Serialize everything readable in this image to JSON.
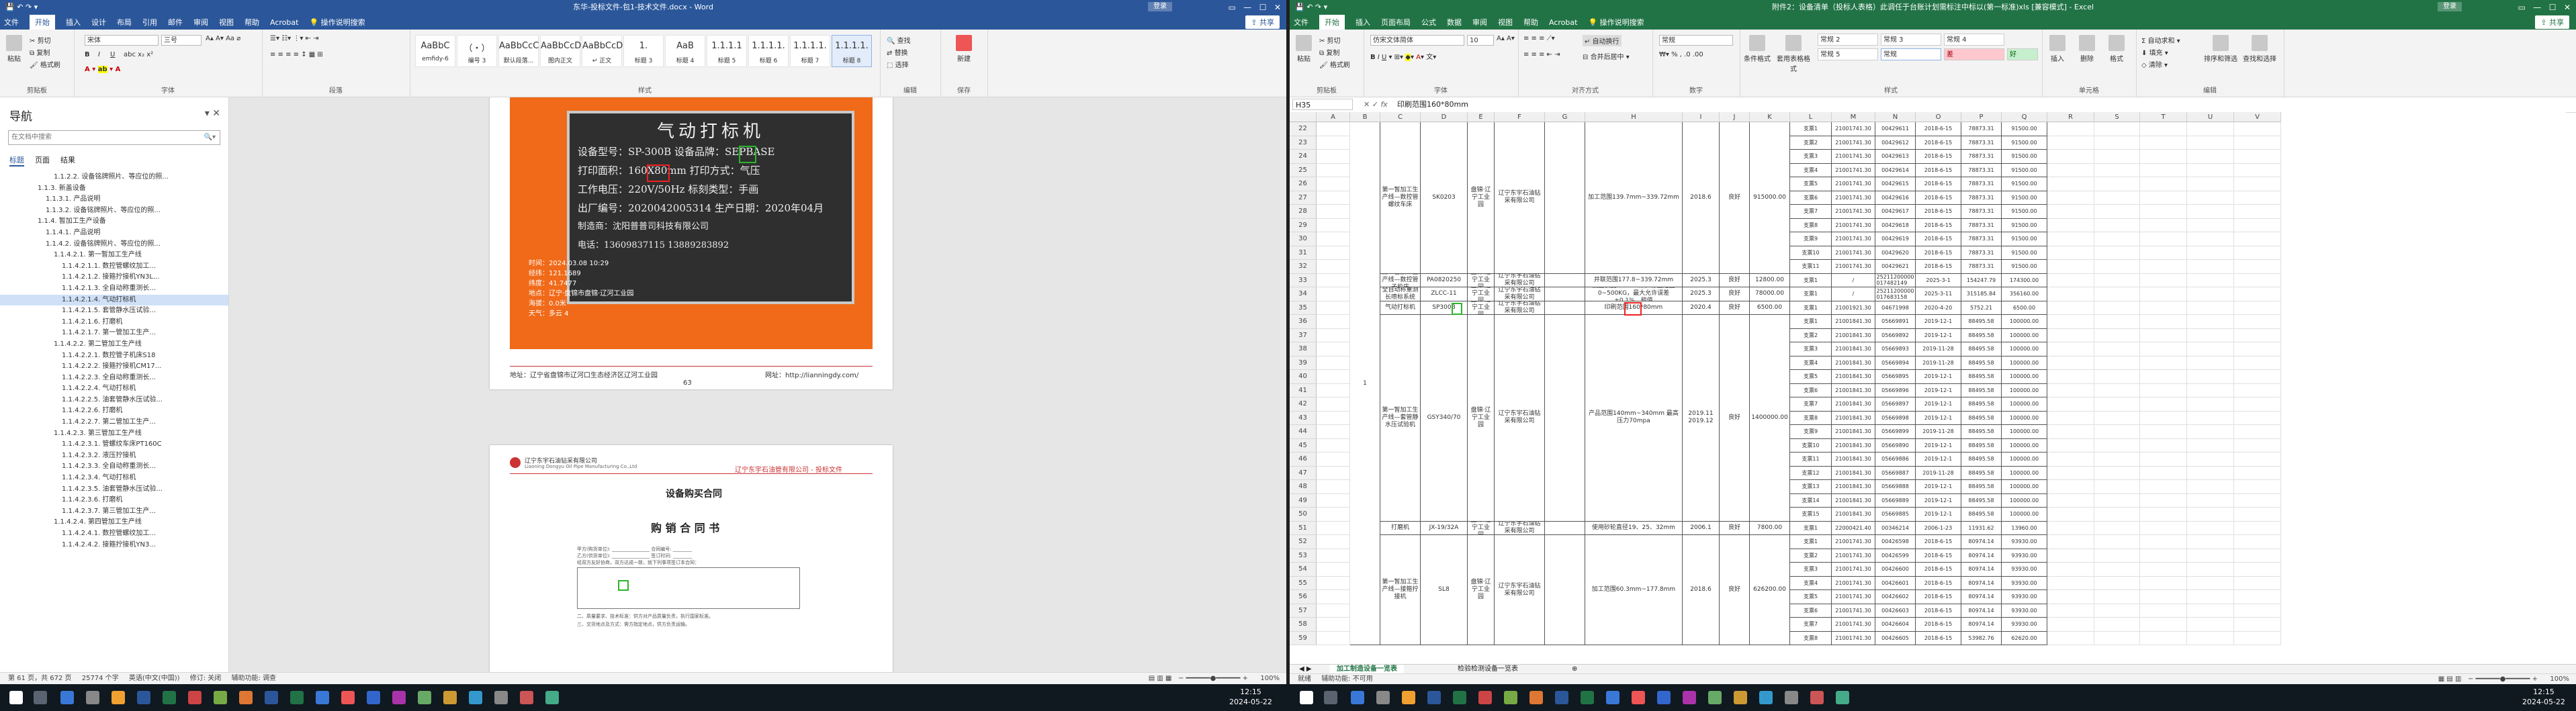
{
  "word": {
    "title": "东华-投标文件-包1-技术文件.docx  -  Word",
    "login": "登录",
    "menu": [
      "文件",
      "开始",
      "插入",
      "设计",
      "布局",
      "引用",
      "邮件",
      "审阅",
      "视图",
      "帮助",
      "Acrobat",
      "操作说明搜索"
    ],
    "share": "共享",
    "ribbon": {
      "paste": "粘贴",
      "cut": "剪切",
      "copy": "复制",
      "format_painter": "格式刷",
      "clipboard": "剪贴板",
      "font_name": "宋体",
      "font_size": "三号",
      "font": "字体",
      "paragraph": "段落",
      "styles_label": "样式",
      "styles": [
        {
          "sample": "AaBbC",
          "name": "emfidy-6"
        },
        {
          "sample": "（・）",
          "name": "编号 3"
        },
        {
          "sample": "AaBbCcC",
          "name": "默认段落..."
        },
        {
          "sample": "AaBbCcD",
          "name": "图内正文"
        },
        {
          "sample": "AaBbCcD",
          "name": "↵ 正文"
        },
        {
          "sample": "1.",
          "name": "标题 3"
        },
        {
          "sample": "AaB",
          "name": "标题 4"
        },
        {
          "sample": "1.1.1.1",
          "name": "标题 5"
        },
        {
          "sample": "1.1.1.1.",
          "name": "标题 6"
        },
        {
          "sample": "1.1.1.1.",
          "name": "标题 7"
        },
        {
          "sample": "1.1.1.1.",
          "name": "标题 8"
        }
      ],
      "find": "查找",
      "replace": "替换",
      "select": "选择",
      "editing": "编辑",
      "wps": "新建",
      "save_label": "保存"
    },
    "nav": {
      "title": "导航",
      "search_placeholder": "在文档中搜索",
      "tabs": [
        "标题",
        "页面",
        "结果"
      ],
      "items": [
        {
          "text": "1.1.2.2. 设备铭牌照片、等应位的照...",
          "indent": 60
        },
        {
          "text": "1.1.3. 新盖设备",
          "indent": 36
        },
        {
          "text": "1.1.3.1. 产品说明",
          "indent": 48
        },
        {
          "text": "1.1.3.2. 设备铭牌照片、等应位的照...",
          "indent": 48
        },
        {
          "text": "1.1.4. 暂加工生产设备",
          "indent": 36
        },
        {
          "text": "1.1.4.1. 产品说明",
          "indent": 48
        },
        {
          "text": "1.1.4.2. 设备铭牌照片、等应位的照...",
          "indent": 48
        },
        {
          "text": "1.1.4.2.1. 第一暂加工生产线",
          "indent": 60
        },
        {
          "text": "1.1.4.2.1.1. 数控管螺纹加工...",
          "indent": 72
        },
        {
          "text": "1.1.4.2.1.2. 接箍拧接机YN3L...",
          "indent": 72
        },
        {
          "text": "1.1.4.2.1.3. 全自动称重测长...",
          "indent": 72
        },
        {
          "text": "1.1.4.2.1.4. 气动打标机",
          "indent": 72,
          "sel": true
        },
        {
          "text": "1.1.4.2.1.5. 套管静水压试验...",
          "indent": 72
        },
        {
          "text": "1.1.4.2.1.6. 打磨机",
          "indent": 72
        },
        {
          "text": "1.1.4.2.1.7. 第一管加工生产...",
          "indent": 72
        },
        {
          "text": "1.1.4.2.2. 第二管加工生产线",
          "indent": 60
        },
        {
          "text": "1.1.4.2.2.1. 数控管子机床S18",
          "indent": 72
        },
        {
          "text": "1.1.4.2.2.2. 接箍拧接机CM17...",
          "indent": 72
        },
        {
          "text": "1.1.4.2.2.3. 全自动称重测长...",
          "indent": 72
        },
        {
          "text": "1.1.4.2.2.4. 气动打标机",
          "indent": 72
        },
        {
          "text": "1.1.4.2.2.5. 油套管静水压试验...",
          "indent": 72
        },
        {
          "text": "1.1.4.2.2.6. 打磨机",
          "indent": 72
        },
        {
          "text": "1.1.4.2.2.7. 第二管加工生产...",
          "indent": 72
        },
        {
          "text": "1.1.4.2.3. 第三管加工生产线",
          "indent": 60
        },
        {
          "text": "1.1.4.2.3.1. 管螺纹车床PT160C",
          "indent": 72
        },
        {
          "text": "1.1.4.2.3.2. 液压拧接机",
          "indent": 72
        },
        {
          "text": "1.1.4.2.3.3. 全自动称重测长...",
          "indent": 72
        },
        {
          "text": "1.1.4.2.3.4. 气动打标机",
          "indent": 72
        },
        {
          "text": "1.1.4.2.3.5. 油套管静水压试验...",
          "indent": 72
        },
        {
          "text": "1.1.4.2.3.6. 打磨机",
          "indent": 72
        },
        {
          "text": "1.1.4.2.3.7. 第三管加工生产...",
          "indent": 72
        },
        {
          "text": "1.1.4.2.4. 第四管加工生产线",
          "indent": 60
        },
        {
          "text": "1.1.4.2.4.1. 数控管螺纹加工...",
          "indent": 72
        },
        {
          "text": "1.1.4.2.4.2. 接箍拧接机YN3...",
          "indent": 72
        }
      ]
    },
    "plate": {
      "title": "气动打标机",
      "rows": [
        "设备型号：SP-300B  设备品牌：SEPBASE",
        "打印面积：160X80mm   打印方式：气压",
        "工作电压：220V/50Hz   标刻类型：手画",
        "出厂编号：2020042005314 生产日期：2020年04月",
        "制造商：沈阳普普司科技有限公司",
        "电话：13609837115 13889283892"
      ],
      "photo_caption": [
        "时间：2024.03.08  10:29",
        "经纬：121.1689",
        "纬度：41.7477",
        "地点：辽宁·盘锦市盘锦·辽河工业园",
        "海拔：0.0米",
        "天气：多云 4"
      ]
    },
    "page1_footer_left": "地址：辽宁省盘锦市辽河口生态经济区辽河工业园",
    "page1_footer_right": "网址：http://lianningdy.com/",
    "page1_number": "63",
    "page2_header_company": "辽宁东宇石油钻采有限公司",
    "page2_header_en": "Liaoning Dongyu Oil Pipe Manufacturing Co.,Ltd",
    "page2_header_right": "辽宁东宇石油管有限公司 - 投标文件",
    "page2_section": "设备购买合同",
    "contract_title": "购 销 合 同 书",
    "status": {
      "page": "第 61 页，共 672 页",
      "words": "25774 个字",
      "lang": "英语(中文(中国))",
      "track": "修订: 关闭",
      "accessibility": "辅助功能: 调查",
      "zoom": "100%"
    }
  },
  "excel": {
    "title": "附件2：设备清单（投标人表格）此调任于台账计划需标注中标以(第一标准)xls [兼容模式]  -  Excel",
    "login": "登录",
    "menu": [
      "文件",
      "开始",
      "插入",
      "页面布局",
      "公式",
      "数据",
      "审阅",
      "视图",
      "帮助",
      "Acrobat",
      "操作说明搜索"
    ],
    "share": "共享",
    "ribbon": {
      "paste": "粘贴",
      "clipboard": "剪贴板",
      "font_name": "仿宋文体简体",
      "font_size": "10",
      "font": "字体",
      "alignment": "对齐方式",
      "wrap": "自动换行",
      "merge": "合并后居中",
      "number_format": "常规",
      "number": "数字",
      "cond_format": "条件格式",
      "table_format": "套用表格格式",
      "styles_label": "样式",
      "cell_styles": [
        {
          "name": "常规 2",
          "bg": "#ffffff"
        },
        {
          "name": "常规 3",
          "bg": "#ffffff"
        },
        {
          "name": "常规 4",
          "bg": "#ffffff"
        },
        {
          "name": "常规 5",
          "bg": "#ffffff"
        },
        {
          "name": "常规",
          "bg": "#ffffff"
        },
        {
          "name": "差",
          "bg": "#ffc7ce"
        },
        {
          "name": "好",
          "bg": "#c6efce"
        }
      ],
      "insert": "插入",
      "delete": "删除",
      "format": "格式",
      "cells": "单元格",
      "autosum": "自动求和",
      "fill": "填充",
      "clear": "清除",
      "sort_filter": "排序和筛选",
      "find_select": "查找和选择",
      "editing": "编辑"
    },
    "namebox": "H35",
    "formula": "印刷范围160*80mm",
    "columns": [
      "A",
      "B",
      "C",
      "D",
      "E",
      "F",
      "G",
      "H",
      "I",
      "J",
      "K",
      "L",
      "M",
      "N",
      "O",
      "P",
      "Q",
      "R",
      "S",
      "T",
      "U",
      "V"
    ],
    "rows": [
      {
        "num": "22",
        "l": "支票1",
        "m": "21001741.30",
        "n": "00429611",
        "o": "2018-6-15",
        "p": "78873.31",
        "q": "91500.00"
      },
      {
        "num": "23",
        "l": "支票2",
        "m": "21001741.30",
        "n": "00429612",
        "o": "2018-6-15",
        "p": "78873.31",
        "q": "91500.00"
      },
      {
        "num": "24",
        "l": "支票3",
        "m": "21001741.30",
        "n": "00429613",
        "o": "2018-6-15",
        "p": "78873.31",
        "q": "91500.00"
      },
      {
        "num": "25",
        "l": "支票4",
        "m": "21001741.30",
        "n": "00429614",
        "o": "2018-6-15",
        "p": "78873.31",
        "q": "91500.00"
      },
      {
        "num": "26",
        "l": "支票5",
        "m": "21001741.30",
        "n": "00429615",
        "o": "2018-6-15",
        "p": "78873.31",
        "q": "91500.00"
      },
      {
        "num": "27",
        "l": "支票6",
        "m": "21001741.30",
        "n": "00429616",
        "o": "2018-6-15",
        "p": "78873.31",
        "q": "91500.00"
      },
      {
        "num": "28",
        "l": "支票7",
        "m": "21001741.30",
        "n": "00429617",
        "o": "2018-6-15",
        "p": "78873.31",
        "q": "91500.00"
      },
      {
        "num": "29",
        "l": "支票8",
        "m": "21001741.30",
        "n": "00429618",
        "o": "2018-6-15",
        "p": "78873.31",
        "q": "91500.00"
      },
      {
        "num": "30",
        "l": "支票9",
        "m": "21001741.30",
        "n": "00429619",
        "o": "2018-6-15",
        "p": "78873.31",
        "q": "91500.00"
      },
      {
        "num": "31",
        "l": "支票10",
        "m": "21001741.30",
        "n": "00429620",
        "o": "2018-6-15",
        "p": "78873.31",
        "q": "91500.00"
      },
      {
        "num": "32",
        "l": "支票11",
        "m": "21001741.30",
        "n": "00429621",
        "o": "2018-6-15",
        "p": "78873.31",
        "q": "91500.00"
      },
      {
        "num": "33",
        "l": "支票1",
        "m": "/",
        "n": "25211200000\n017482149",
        "o": "2025-3-1",
        "p": "154247.79",
        "q": "174300.00"
      },
      {
        "num": "34",
        "l": "支票1",
        "m": "/",
        "n": "25211200000\n017683158",
        "o": "2025-3-11",
        "p": "315185.84",
        "q": "356160.00"
      },
      {
        "num": "35",
        "l": "支票1",
        "m": "21001921.30",
        "n": "04671998",
        "o": "2020-4-20",
        "p": "5752.21",
        "q": "6500.00"
      },
      {
        "num": "36",
        "l": "支票1",
        "m": "21001841.30",
        "n": "05669891",
        "o": "2019-12-1",
        "p": "88495.58",
        "q": "100000.00"
      },
      {
        "num": "37",
        "l": "支票2",
        "m": "21001841.30",
        "n": "05669892",
        "o": "2019-12-1",
        "p": "88495.58",
        "q": "100000.00"
      },
      {
        "num": "38",
        "l": "支票3",
        "m": "21001841.30",
        "n": "05669893",
        "o": "2019-11-28",
        "p": "88495.58",
        "q": "100000.00"
      },
      {
        "num": "39",
        "l": "支票4",
        "m": "21001841.30",
        "n": "05669894",
        "o": "2019-11-28",
        "p": "88495.58",
        "q": "100000.00"
      },
      {
        "num": "40",
        "l": "支票5",
        "m": "21001841.30",
        "n": "05669895",
        "o": "2019-12-1",
        "p": "88495.58",
        "q": "100000.00"
      },
      {
        "num": "41",
        "l": "支票6",
        "m": "21001841.30",
        "n": "05669896",
        "o": "2019-12-1",
        "p": "88495.58",
        "q": "100000.00"
      },
      {
        "num": "42",
        "l": "支票7",
        "m": "21001841.30",
        "n": "05669897",
        "o": "2019-12-1",
        "p": "88495.58",
        "q": "100000.00"
      },
      {
        "num": "43",
        "l": "支票8",
        "m": "21001841.30",
        "n": "05669898",
        "o": "2019-12-1",
        "p": "88495.58",
        "q": "100000.00"
      },
      {
        "num": "44",
        "l": "支票9",
        "m": "21001841.30",
        "n": "05669899",
        "o": "2019-11-28",
        "p": "88495.58",
        "q": "100000.00"
      },
      {
        "num": "45",
        "l": "支票10",
        "m": "21001841.30",
        "n": "05669890",
        "o": "2019-12-1",
        "p": "88495.58",
        "q": "100000.00"
      },
      {
        "num": "46",
        "l": "支票11",
        "m": "21001841.30",
        "n": "05669886",
        "o": "2019-12-1",
        "p": "88495.58",
        "q": "100000.00"
      },
      {
        "num": "47",
        "l": "支票12",
        "m": "21001841.30",
        "n": "05669887",
        "o": "2019-11-28",
        "p": "88495.58",
        "q": "100000.00"
      },
      {
        "num": "48",
        "l": "支票13",
        "m": "21001841.30",
        "n": "05669888",
        "o": "2019-12-1",
        "p": "88495.58",
        "q": "100000.00"
      },
      {
        "num": "49",
        "l": "支票14",
        "m": "21001841.30",
        "n": "05669889",
        "o": "2019-12-1",
        "p": "88495.58",
        "q": "100000.00"
      },
      {
        "num": "50",
        "l": "支票15",
        "m": "21001841.30",
        "n": "05669885",
        "o": "2019-12-1",
        "p": "88495.58",
        "q": "100000.00"
      },
      {
        "num": "51",
        "l": "支票1",
        "m": "22000421.40",
        "n": "00346214",
        "o": "2006-1-23",
        "p": "11931.62",
        "q": "13960.00"
      },
      {
        "num": "52",
        "l": "支票1",
        "m": "21001741.30",
        "n": "00426598",
        "o": "2018-6-15",
        "p": "80974.14",
        "q": "93930.00"
      },
      {
        "num": "53",
        "l": "支票2",
        "m": "21001741.30",
        "n": "00426599",
        "o": "2018-6-15",
        "p": "80974.14",
        "q": "93930.00"
      },
      {
        "num": "54",
        "l": "支票3",
        "m": "21001741.30",
        "n": "00426600",
        "o": "2018-6-15",
        "p": "80974.14",
        "q": "93930.00"
      },
      {
        "num": "55",
        "l": "支票4",
        "m": "21001741.30",
        "n": "00426601",
        "o": "2018-6-15",
        "p": "80974.14",
        "q": "93930.00"
      },
      {
        "num": "56",
        "l": "支票5",
        "m": "21001741.30",
        "n": "00426602",
        "o": "2018-6-15",
        "p": "80974.14",
        "q": "93930.00"
      },
      {
        "num": "57",
        "l": "支票6",
        "m": "21001741.30",
        "n": "00426603",
        "o": "2018-6-15",
        "p": "80974.14",
        "q": "93930.00"
      },
      {
        "num": "58",
        "l": "支票7",
        "m": "21001741.30",
        "n": "00426604",
        "o": "2018-6-15",
        "p": "80974.14",
        "q": "93930.00"
      },
      {
        "num": "59",
        "l": "支票8",
        "m": "21001741.30",
        "n": "00426605",
        "o": "2018-6-15",
        "p": "53982.76",
        "q": "62620.00"
      }
    ],
    "groups": [
      {
        "start": 0,
        "end": 10,
        "c": "第一暂加工生产线—数控管螺纹车床",
        "d": "SK0203",
        "e": "盘锦·辽宁工业园",
        "f": "辽宁东宇石油钻采有限公司",
        "h": "加工范围139.7mm~339.72mm",
        "i": "2018.6",
        "j": "良好",
        "k": "915000.00"
      },
      {
        "start": 11,
        "end": 11,
        "c": "第一暂加工生产线—数控管子机床",
        "d": "PA0820250",
        "e": "盘锦·辽宁工业园",
        "f": "辽宁东宇石油钻采有限公司",
        "h": "并联范围177.8~339.72mm",
        "i": "2025.3",
        "j": "良好",
        "k": "12800.00"
      },
      {
        "start": 12,
        "end": 12,
        "c": "全自动称重测长喷标系统",
        "d": "ZLCC-11",
        "e": "盘锦·辽宁工业园",
        "f": "辽宁东宇石油钻采有限公司",
        "h": "测量长度9~12.5米，称重范围0~500KG，最大允许误差±0.1%，称值",
        "i": "2025.3",
        "j": "良好",
        "k": "78000.00"
      },
      {
        "start": 13,
        "end": 13,
        "c": "气动打标机",
        "d": "SP300B",
        "e": "盘锦·辽宁工业园",
        "f": "辽宁东宇石油钻采有限公司",
        "h": "印刷范围160*80mm",
        "i": "2020.4",
        "j": "良好",
        "k": "6500.00"
      },
      {
        "start": 14,
        "end": 28,
        "c": "第一暂加工生产线—套管静水压试验机",
        "d": "GSY340/70",
        "e": "盘锦·辽宁工业园",
        "f": "辽宁东宇石油钻采有限公司",
        "h": "产品范围140mm~340mm 最高压力70mpa",
        "i": "2019.11\n2019.12",
        "j": "良好",
        "k": "1400000.00"
      },
      {
        "start": 29,
        "end": 29,
        "c": "打磨机",
        "d": "JX-19/32A",
        "e": "盘锦·辽宁工业园",
        "f": "辽宁东宇石油钻采有限公司",
        "h": "使用砂轮直径19、25、32mm",
        "i": "2006.1",
        "j": "良好",
        "k": "7800.00"
      },
      {
        "start": 30,
        "end": 37,
        "c": "第一暂加工生产线—接箍拧接机",
        "d": "SL8",
        "e": "盘锦·辽宁工业园",
        "f": "辽宁东宇石油钻采有限公司",
        "h": "加工范围60.3mm~177.8mm",
        "i": "2018.6",
        "j": "良好",
        "k": "626200.00"
      }
    ],
    "b_value": "1",
    "sheets": [
      "加工制造设备一览表",
      "检验检测设备一览表"
    ],
    "status": {
      "ready": "就绪",
      "accessibility": "辅助功能: 不可用",
      "zoom": "100%"
    }
  },
  "taskbar": {
    "time_left": "12:15",
    "date_left": "2024-05-22",
    "time_right": "12:15",
    "date_right": "2024-05-22"
  }
}
